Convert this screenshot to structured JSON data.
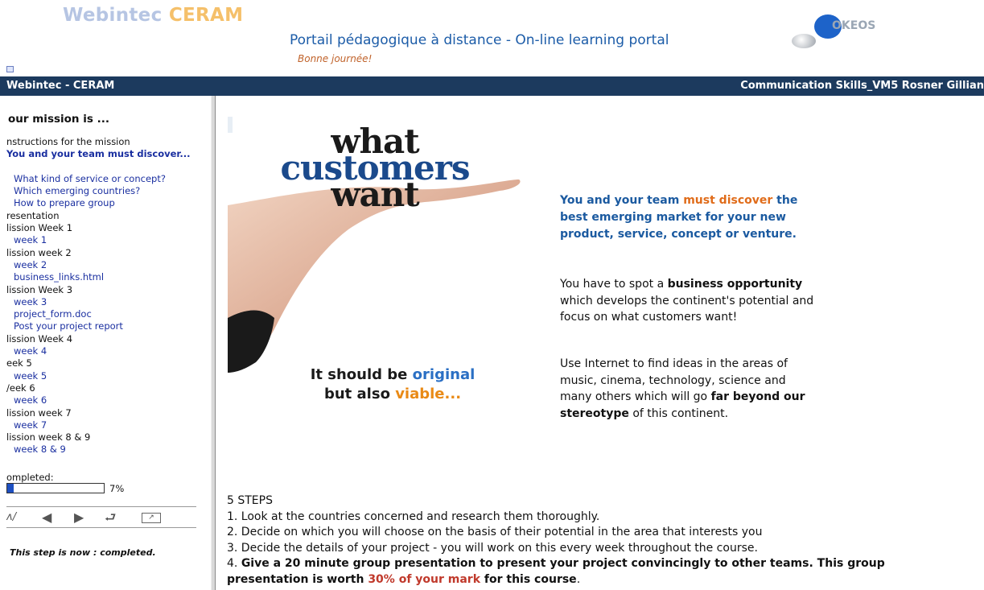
{
  "header": {
    "logo_left_a": "Webintec ",
    "logo_left_b": "CERAM",
    "portal_title": "Portail pédagogique à distance - On-line learning portal",
    "greeting": "Bonne journée!",
    "logo_right": "OKEOS"
  },
  "topbar": {
    "left": "Webintec - CERAM",
    "right": "Communication Skills_VM5 Rosner Gillian"
  },
  "sidebar": {
    "title": "our mission is ...",
    "toc": [
      {
        "label": "nstructions for the mission",
        "kind": "chapter"
      },
      {
        "label": "You and your team must discover...",
        "kind": "current"
      },
      {
        "label": "What kind of service or concept?",
        "kind": "link"
      },
      {
        "label": "Which emerging countries?",
        "kind": "link"
      },
      {
        "label": "How to prepare group",
        "kind": "link"
      },
      {
        "label": "resentation",
        "kind": "chapter"
      },
      {
        "label": "lission Week 1",
        "kind": "chapter"
      },
      {
        "label": "week 1",
        "kind": "link"
      },
      {
        "label": "lission week 2",
        "kind": "chapter"
      },
      {
        "label": "week 2",
        "kind": "link"
      },
      {
        "label": "business_links.html",
        "kind": "link"
      },
      {
        "label": "lission Week 3",
        "kind": "chapter"
      },
      {
        "label": "week 3",
        "kind": "link"
      },
      {
        "label": "project_form.doc",
        "kind": "link"
      },
      {
        "label": "Post your project report",
        "kind": "link"
      },
      {
        "label": "lission Week 4",
        "kind": "chapter"
      },
      {
        "label": "week 4",
        "kind": "link"
      },
      {
        "label": "eek 5",
        "kind": "chapter"
      },
      {
        "label": "week 5",
        "kind": "link"
      },
      {
        "label": "/eek 6",
        "kind": "chapter"
      },
      {
        "label": "week 6",
        "kind": "link"
      },
      {
        "label": "lission week 7",
        "kind": "chapter"
      },
      {
        "label": "week 7",
        "kind": "link"
      },
      {
        "label": "lission week 8 & 9",
        "kind": "chapter"
      },
      {
        "label": "week 8 & 9",
        "kind": "link"
      }
    ],
    "progress_label": "ompleted:",
    "progress_fraction": 0.07,
    "progress_pct": "7%",
    "step_status": "This step is now : completed."
  },
  "content": {
    "pic_title": [
      "what",
      "customers",
      "want"
    ],
    "pic_caption_a": "It should be ",
    "pic_caption_b": "original",
    "pic_caption_c": "but also ",
    "pic_caption_d": "viable",
    "pic_caption_e": "...",
    "headline_a": "You and your team ",
    "headline_b": "must discover",
    "headline_c": " the best emerging market for your new product, service, concept or venture.",
    "para1_a": "You have to spot a ",
    "para1_b": "business opportunity",
    "para1_c": " which develops the continent's potential and focus on what customers want!",
    "para2_a": "Use Internet to find ideas in the areas of music, cinema, technology, science and many others which will go ",
    "para2_b": "far beyond our stereotype",
    "para2_c": " of this continent.",
    "steps_title": "5 STEPS",
    "step1": "1. Look at the countries concerned and research them thoroughly.",
    "step2": "2. Decide on which you will choose on the basis of their potential in the area that interests you",
    "step3": "3. Decide the details of your project - you will work on this every week throughout the course.",
    "step4_a": "4. ",
    "step4_b": "Give a 20 minute group presentation to present your project convincingly to other teams. This group",
    "step4_c": "presentation is worth ",
    "step4_d": "30% of your mark",
    "step4_e": " for this course",
    "step4_f": "."
  }
}
